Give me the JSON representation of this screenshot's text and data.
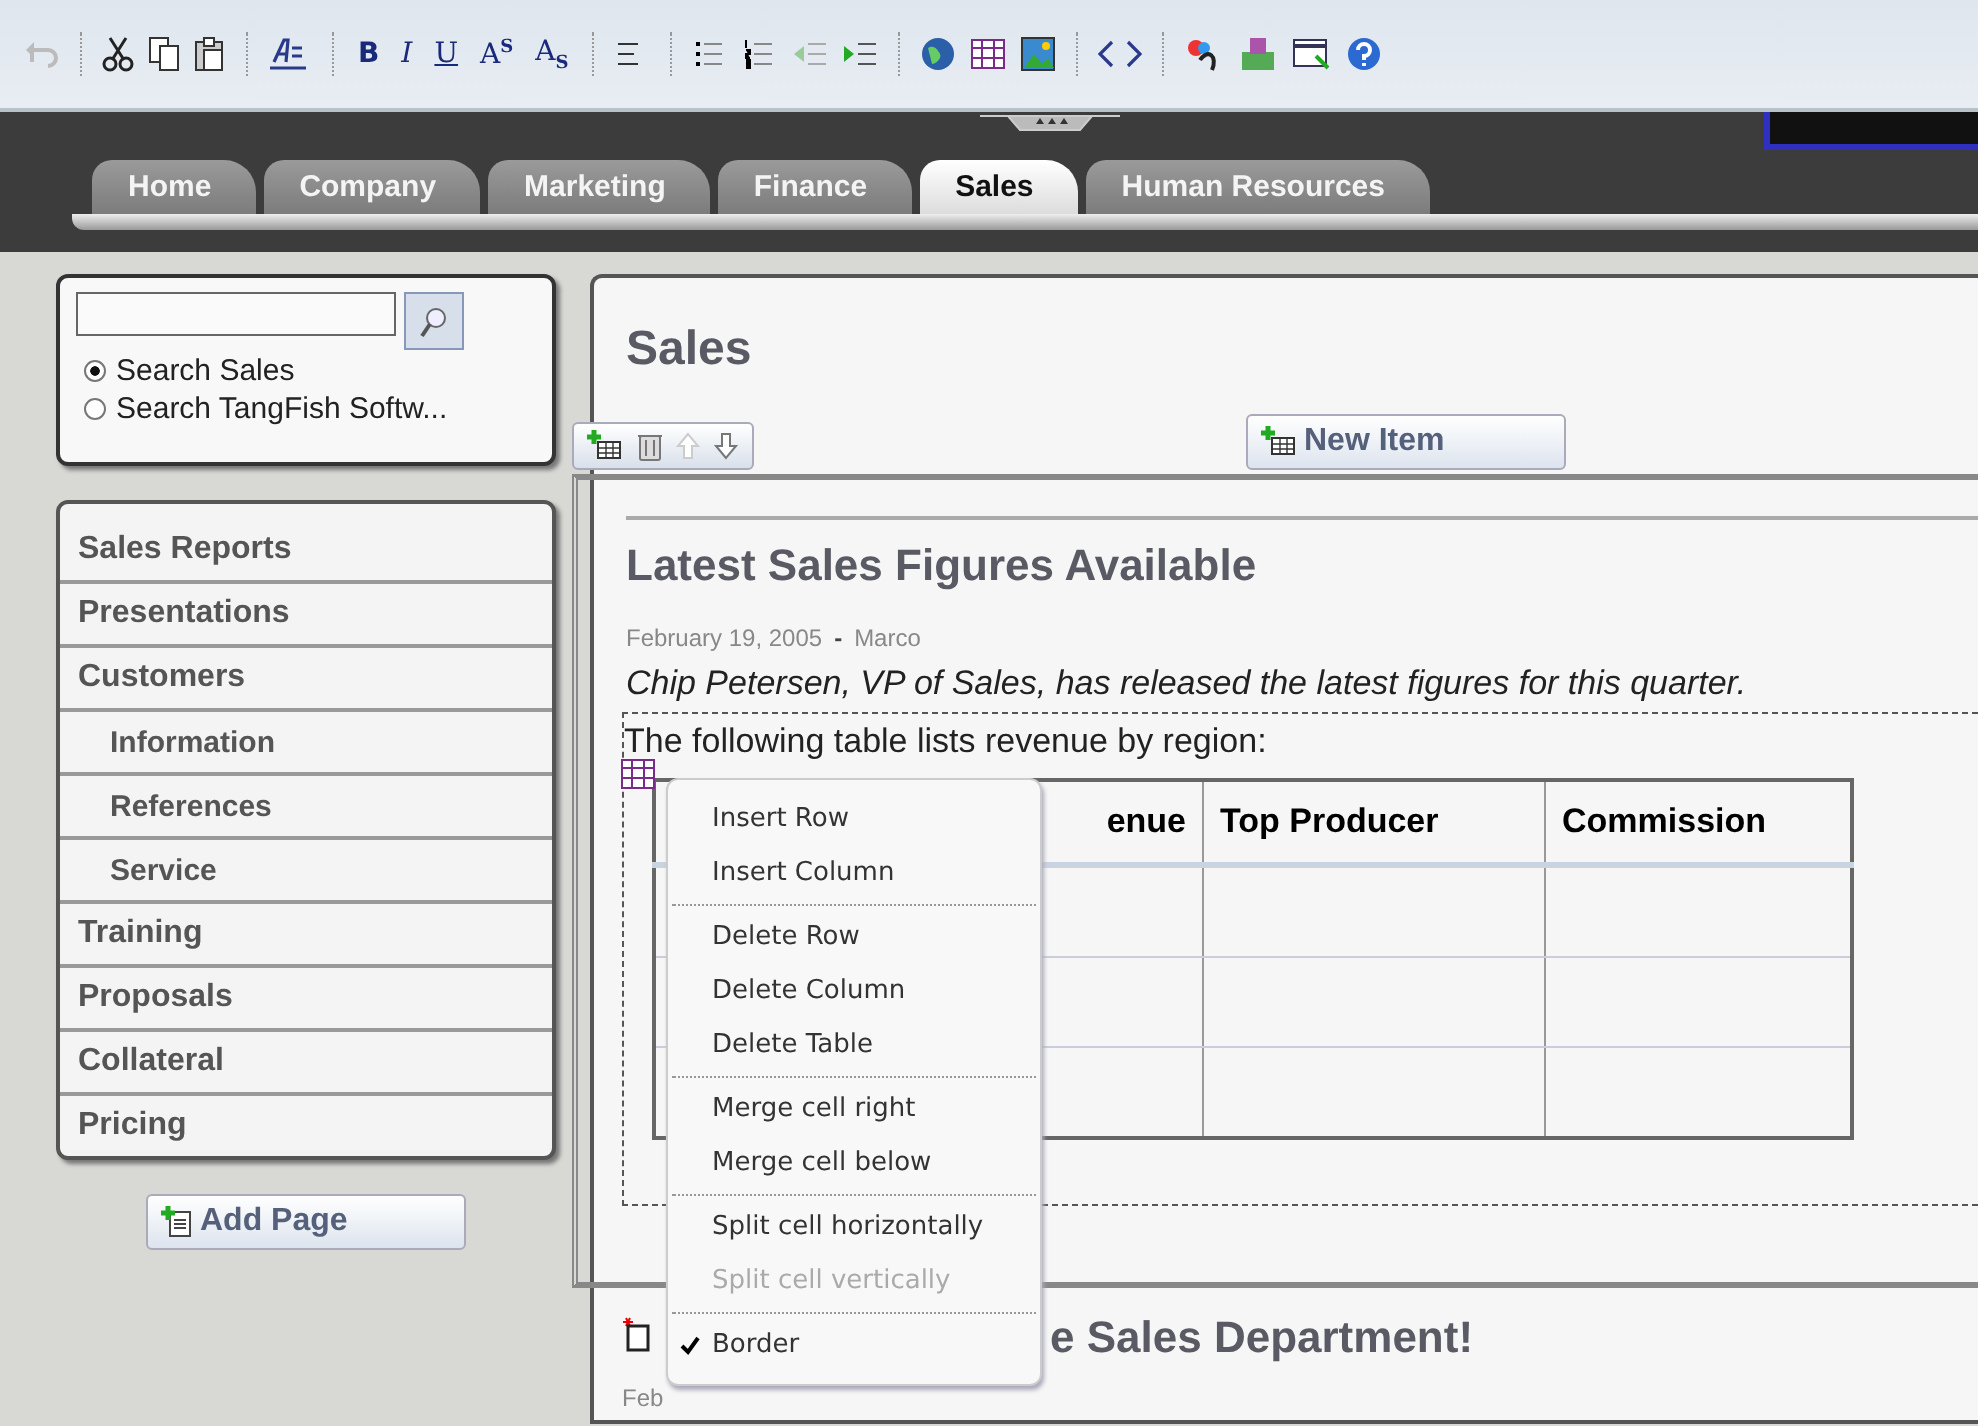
{
  "toolbar": {
    "format_buttons": [
      "B",
      "I",
      "U",
      "A$^{S}$",
      "A$_{S}$"
    ]
  },
  "tabs": [
    {
      "label": "Home",
      "selected": false
    },
    {
      "label": "Company",
      "selected": false
    },
    {
      "label": "Marketing",
      "selected": false
    },
    {
      "label": "Finance",
      "selected": false
    },
    {
      "label": "Sales",
      "selected": true
    },
    {
      "label": "Human Resources",
      "selected": false
    }
  ],
  "search": {
    "options": [
      {
        "label": "Search Sales",
        "selected": true
      },
      {
        "label": "Search TangFish Softw...",
        "selected": false
      }
    ]
  },
  "sidebar": {
    "items": [
      {
        "label": "Sales Reports"
      },
      {
        "label": "Presentations"
      },
      {
        "label": "Customers",
        "children": [
          {
            "label": "Information"
          },
          {
            "label": "References"
          },
          {
            "label": "Service"
          }
        ]
      },
      {
        "label": "Training"
      },
      {
        "label": "Proposals"
      },
      {
        "label": "Collateral"
      },
      {
        "label": "Pricing"
      }
    ],
    "add_button": "Add Page"
  },
  "page": {
    "title": "Sales",
    "new_item_button": "New Item",
    "posts": [
      {
        "title": "Latest Sales Figures Available",
        "date": "February 19, 2005",
        "separator": "-",
        "author": "Marco",
        "lead": "Chip Petersen, VP of Sales, has released the latest figures for this quarter.",
        "body": "The following table lists revenue by region:",
        "table": {
          "columns": [
            "enue",
            "Top Producer",
            "Commission"
          ]
        }
      },
      {
        "title": "e Sales Department!",
        "date": "Feb"
      }
    ]
  },
  "context_menu": {
    "groups": [
      [
        {
          "label": "Insert Row",
          "disabled": false,
          "checked": false
        },
        {
          "label": "Insert Column",
          "disabled": false,
          "checked": false
        }
      ],
      [
        {
          "label": "Delete Row",
          "disabled": false,
          "checked": false
        },
        {
          "label": "Delete Column",
          "disabled": false,
          "checked": false
        },
        {
          "label": "Delete Table",
          "disabled": false,
          "checked": false
        }
      ],
      [
        {
          "label": "Merge cell right",
          "disabled": false,
          "checked": false
        },
        {
          "label": "Merge cell below",
          "disabled": false,
          "checked": false
        }
      ],
      [
        {
          "label": "Split cell horizontally",
          "disabled": false,
          "checked": false
        },
        {
          "label": "Split cell vertically",
          "disabled": true,
          "checked": false
        }
      ],
      [
        {
          "label": "Border",
          "disabled": false,
          "checked": true
        }
      ]
    ]
  }
}
